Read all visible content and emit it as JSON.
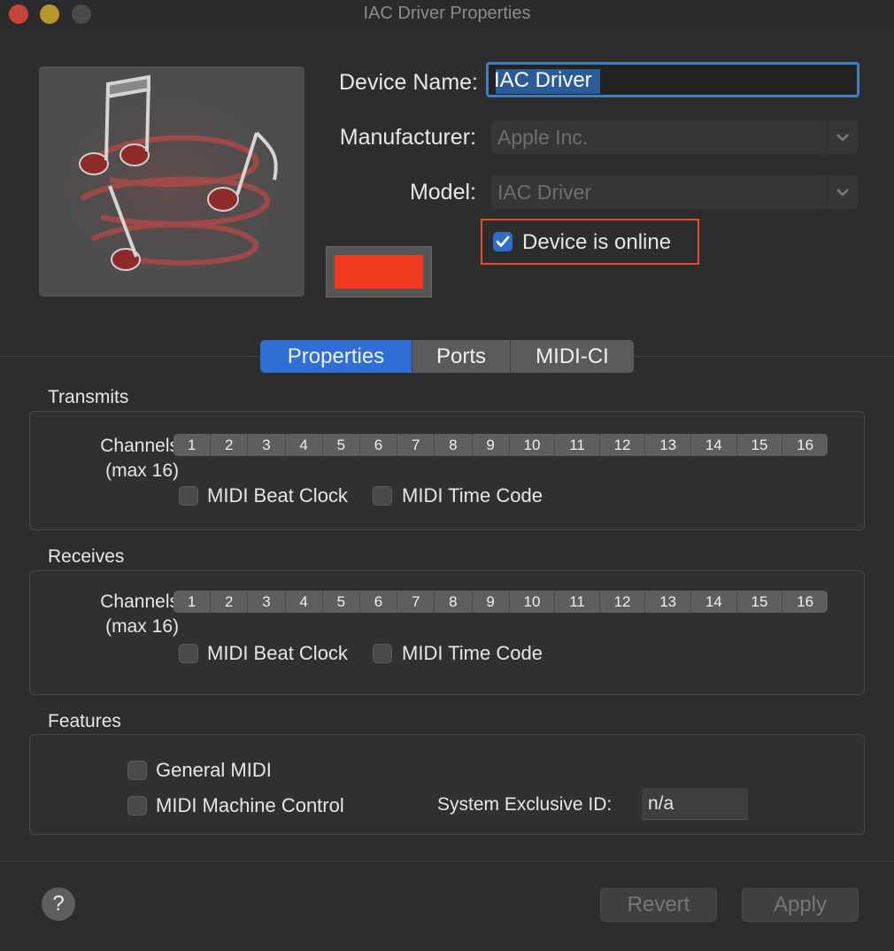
{
  "window": {
    "title": "IAC Driver Properties"
  },
  "device": {
    "name_label": "Device Name:",
    "name_value": "IAC Driver",
    "manufacturer_label": "Manufacturer:",
    "manufacturer_value": "Apple Inc.",
    "model_label": "Model:",
    "model_value": "IAC Driver",
    "online_label": "Device is online",
    "online_checked": true,
    "color": "#f03a20",
    "icon": "midi-notes-icon"
  },
  "tabs": [
    {
      "label": "Properties",
      "active": true
    },
    {
      "label": "Ports",
      "active": false
    },
    {
      "label": "MIDI-CI",
      "active": false
    }
  ],
  "transmits": {
    "title": "Transmits",
    "channels_label_1": "Channels",
    "channels_label_2": "(max 16)",
    "channels": [
      "1",
      "2",
      "3",
      "4",
      "5",
      "6",
      "7",
      "8",
      "9",
      "10",
      "11",
      "12",
      "13",
      "14",
      "15",
      "16"
    ],
    "beat_clock_label": "MIDI Beat Clock",
    "beat_clock_checked": false,
    "time_code_label": "MIDI Time Code",
    "time_code_checked": false
  },
  "receives": {
    "title": "Receives",
    "channels_label_1": "Channels",
    "channels_label_2": "(max 16)",
    "channels": [
      "1",
      "2",
      "3",
      "4",
      "5",
      "6",
      "7",
      "8",
      "9",
      "10",
      "11",
      "12",
      "13",
      "14",
      "15",
      "16"
    ],
    "beat_clock_label": "MIDI Beat Clock",
    "beat_clock_checked": false,
    "time_code_label": "MIDI Time Code",
    "time_code_checked": false
  },
  "features": {
    "title": "Features",
    "general_midi_label": "General MIDI",
    "general_midi_checked": false,
    "machine_control_label": "MIDI Machine Control",
    "machine_control_checked": false,
    "sysex_label": "System Exclusive ID:",
    "sysex_value": "n/a"
  },
  "footer": {
    "help_label": "?",
    "revert_label": "Revert",
    "apply_label": "Apply"
  }
}
